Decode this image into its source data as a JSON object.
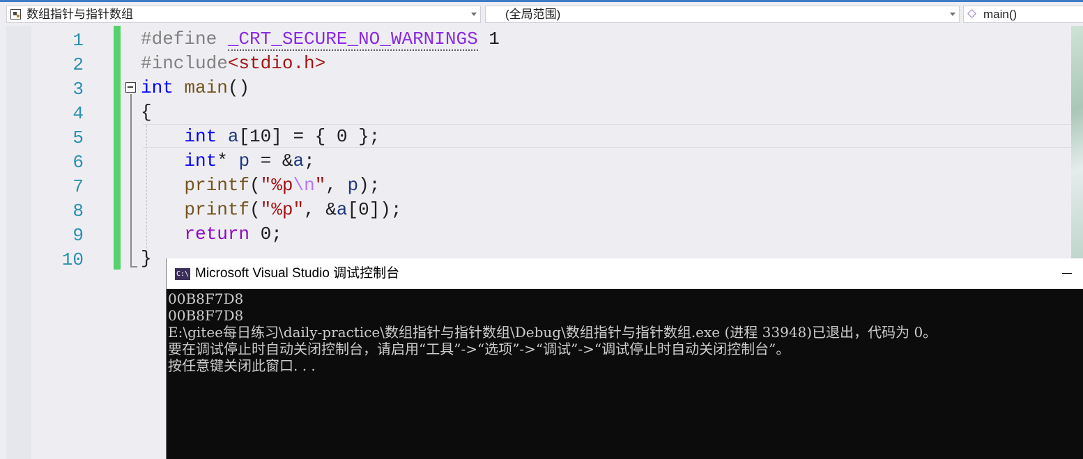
{
  "navbar": {
    "project_dropdown": "数组指针与指针数组",
    "scope_dropdown": "(全局范围)",
    "member_dropdown": "main()"
  },
  "editor": {
    "line_numbers": [
      "1",
      "2",
      "3",
      "4",
      "5",
      "6",
      "7",
      "8",
      "9",
      "10"
    ],
    "code_lines": [
      "#define _CRT_SECURE_NO_WARNINGS 1",
      "#include<stdio.h>",
      "int main()",
      "{",
      "    int a[10] = { 0 };",
      "    int* p = &a;",
      "    printf(\"%p\\n\", p);",
      "    printf(\"%p\", &a[0]);",
      "    return 0;",
      "}"
    ],
    "tokens": {
      "l1": [
        "#define",
        "_CRT_SECURE_NO_WARNINGS",
        "1"
      ],
      "l2": [
        "#include",
        "<stdio.h>"
      ],
      "l3": [
        "int",
        "main",
        "()"
      ],
      "l4": [
        "{"
      ],
      "l5": [
        "int",
        "a",
        "[10] = { 0 };"
      ],
      "l6": [
        "int",
        "* ",
        "p",
        " = &",
        "a",
        ";"
      ],
      "l7": [
        "printf",
        "(",
        "\"%p",
        "\\n",
        "\"",
        ", ",
        "p",
        ");"
      ],
      "l8": [
        "printf",
        "(",
        "\"%p\"",
        ", &",
        "a",
        "[0]);"
      ],
      "l9": [
        "return",
        " 0;"
      ],
      "l10": [
        "}"
      ]
    }
  },
  "console": {
    "title": "Microsoft Visual Studio 调试控制台",
    "icon_text": "C:\\",
    "output_lines": [
      "00B8F7D8",
      "00B8F7D8",
      "E:\\gitee每日练习\\daily-practice\\数组指针与指针数组\\Debug\\数组指针与指针数组.exe (进程 33948)已退出，代码为 0。",
      "要在调试停止时自动关闭控制台，请启用“工具”->“选项”->“调试”->“调试停止时自动关闭控制台”。",
      "按任意键关闭此窗口. . ."
    ]
  },
  "colors": {
    "accent": "#3f7bc6",
    "change_bar": "#57d16b",
    "line_number": "#2b91af",
    "keyword": "#0000ff",
    "console_bg": "#0c0c0c"
  }
}
